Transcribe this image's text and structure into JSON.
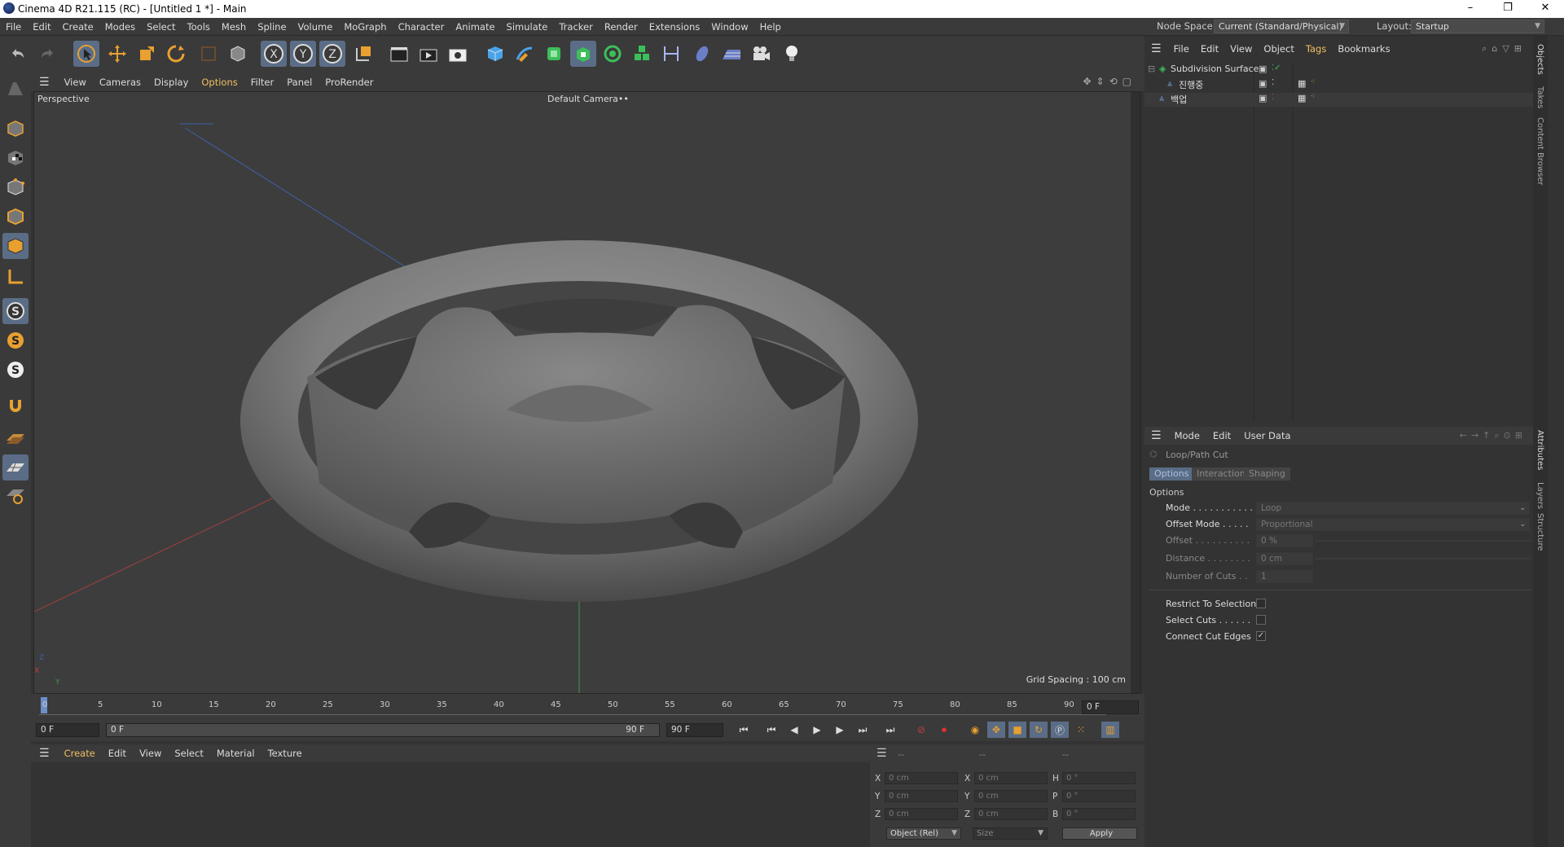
{
  "window": {
    "title": "Cinema 4D R21.115 (RC) - [Untitled 1 *] - Main",
    "minimize": "–",
    "maximize": "❐",
    "close": "✕"
  },
  "menubar": {
    "items": [
      "File",
      "Edit",
      "Create",
      "Modes",
      "Select",
      "Tools",
      "Mesh",
      "Spline",
      "Volume",
      "MoGraph",
      "Character",
      "Animate",
      "Simulate",
      "Tracker",
      "Render",
      "Extensions",
      "Window",
      "Help"
    ],
    "node_space_label": "Node Space:",
    "node_space_value": "Current (Standard/Physical)",
    "layout_label": "Layout:",
    "layout_value": "Startup"
  },
  "viewport": {
    "menu": [
      "View",
      "Cameras",
      "Display",
      "Options",
      "Filter",
      "Panel",
      "ProRender"
    ],
    "highlight": "Options",
    "name": "Perspective",
    "camera": "Default Camera",
    "camera_icon": "••",
    "grid_spacing": "Grid Spacing : 100 cm",
    "axis_labels": [
      "Z",
      "X",
      "Y"
    ]
  },
  "timeline": {
    "ticks": [
      "0",
      "5",
      "10",
      "15",
      "20",
      "25",
      "30",
      "35",
      "40",
      "45",
      "50",
      "55",
      "60",
      "65",
      "70",
      "75",
      "80",
      "85",
      "90"
    ],
    "current_frame": "0 F",
    "start": "0 F",
    "range_start": "0 F",
    "range_end": "90 F",
    "end": "90 F"
  },
  "material": {
    "menu": [
      "Create",
      "Edit",
      "View",
      "Select",
      "Material",
      "Texture"
    ],
    "highlight": "Create"
  },
  "coordinates": {
    "header": [
      "--",
      "--",
      "--"
    ],
    "rows": [
      {
        "a": "X",
        "av": "0 cm",
        "b": "X",
        "bv": "0 cm",
        "c": "H",
        "cv": "0 °"
      },
      {
        "a": "Y",
        "av": "0 cm",
        "b": "Y",
        "bv": "0 cm",
        "c": "P",
        "cv": "0 °"
      },
      {
        "a": "Z",
        "av": "0 cm",
        "b": "Z",
        "bv": "0 cm",
        "c": "B",
        "cv": "0 °"
      }
    ],
    "mode": "Object (Rel)",
    "size": "Size",
    "apply": "Apply"
  },
  "objects": {
    "menu": [
      "File",
      "Edit",
      "View",
      "Object",
      "Tags",
      "Bookmarks"
    ],
    "highlight": "Tags",
    "items": [
      {
        "name": "Subdivision Surface"
      },
      {
        "name": "진행중"
      },
      {
        "name": "백업"
      }
    ]
  },
  "attributes": {
    "menu": [
      "Mode",
      "Edit",
      "User Data"
    ],
    "tool": "Loop/Path Cut",
    "tabs": [
      "Options",
      "Interaction",
      "Shaping"
    ],
    "section": "Options",
    "fields": [
      {
        "label": "Mode . . . . . . . . . . .",
        "value": "Loop"
      },
      {
        "label": "Offset Mode . . . . .",
        "value": "Proportional"
      },
      {
        "label": "Offset . . . . . . . . . .",
        "value": "0 %"
      },
      {
        "label": "Distance . . . . . . . .",
        "value": "0 cm"
      },
      {
        "label": "Number of Cuts . .",
        "value": "1"
      }
    ],
    "checks": [
      {
        "label": "Restrict To Selection",
        "checked": ""
      },
      {
        "label": "Select Cuts . . . . . .",
        "checked": ""
      },
      {
        "label": "Connect Cut Edges",
        "checked": "✓"
      }
    ]
  },
  "side_tabs": [
    "Objects",
    "Takes",
    "Content Browser",
    "Attributes",
    "Layers",
    "Structure"
  ]
}
